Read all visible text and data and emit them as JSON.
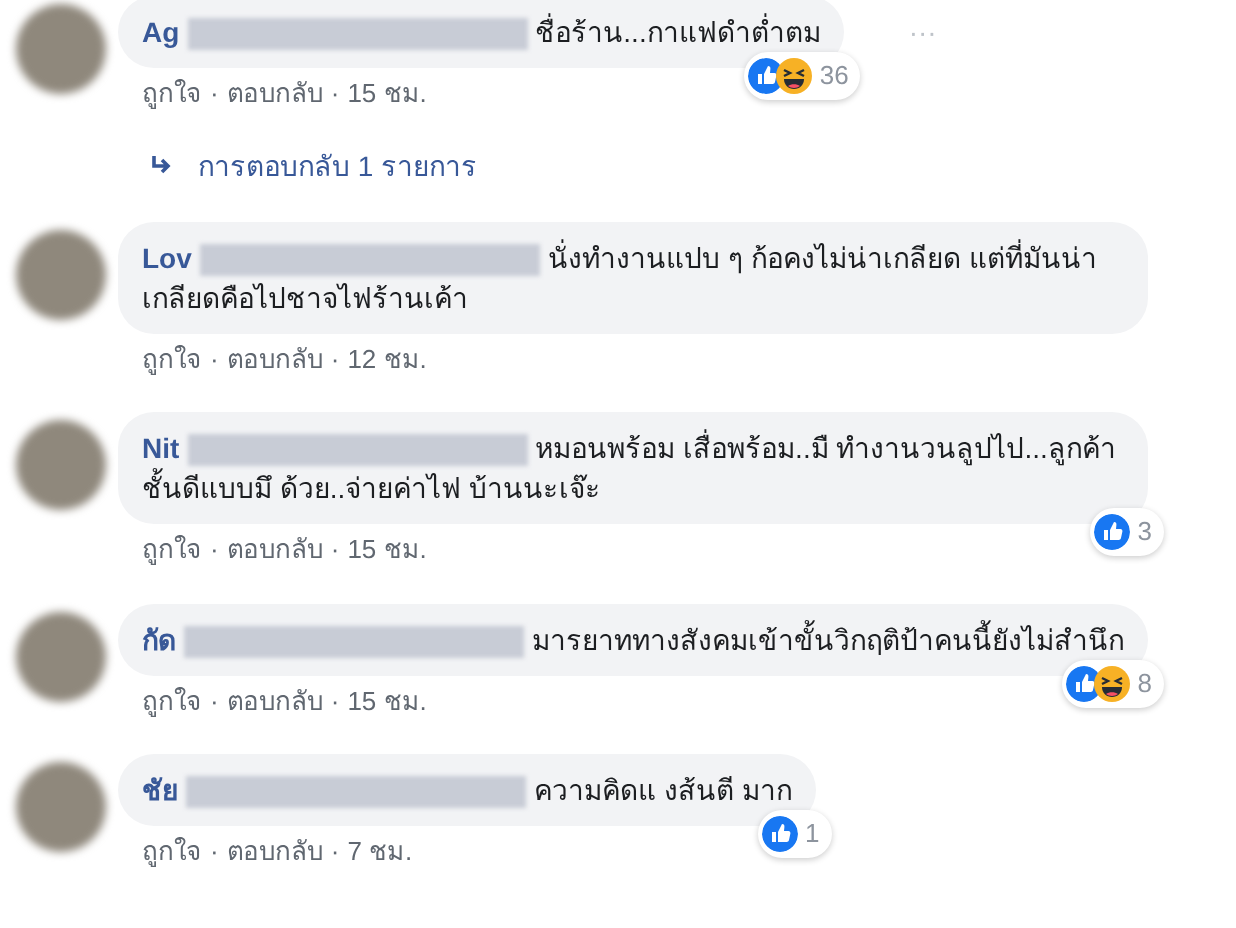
{
  "separator": "·",
  "comments": [
    {
      "name": "Ag",
      "text": "ชื่อร้าน...กาแฟดำต่ำตม",
      "reactions": [
        {
          "kind": "like"
        },
        {
          "kind": "haha"
        }
      ],
      "reaction_count": "36",
      "actions": [
        "ถูกใจ",
        "ตอบกลับ",
        "15 ชม."
      ],
      "more": "···",
      "replies": "การตอบกลับ 1 รายการ"
    },
    {
      "name": "Lov",
      "text": "นั่งทำงานแปบ ๆ ก้อคงไม่น่าเกลียด แต่ที่มันน่าเกลียดคือไปชาจไฟร้านเค้า",
      "actions": [
        "ถูกใจ",
        "ตอบกลับ",
        "12 ชม."
      ]
    },
    {
      "name": "Nit",
      "text": "หมอนพร้อม เสื่อพร้อม..มื ทำงานวนลูปไป...ลูกค้าชั้นดีแบบมึ ด้วย..จ่ายค่าไฟ บ้านนะเจ๊ะ",
      "reactions": [
        {
          "kind": "like"
        }
      ],
      "reaction_count": "3",
      "actions": [
        "ถูกใจ",
        "ตอบกลับ",
        "15 ชม."
      ]
    },
    {
      "name": "กัด",
      "text": "มารยาททางสังคมเข้าขั้นวิกฤติป้าคนนี้ยังไม่สำนึก",
      "reactions": [
        {
          "kind": "like"
        },
        {
          "kind": "haha"
        }
      ],
      "reaction_count": "8",
      "actions": [
        "ถูกใจ",
        "ตอบกลับ",
        "15 ชม."
      ]
    },
    {
      "name": "ชัย",
      "text": "ความคิดแ งส้นตี มาก",
      "reactions": [
        {
          "kind": "like"
        }
      ],
      "reaction_count": "1",
      "actions": [
        "ถูกใจ",
        "ตอบกลับ",
        "7 ชม."
      ]
    }
  ]
}
